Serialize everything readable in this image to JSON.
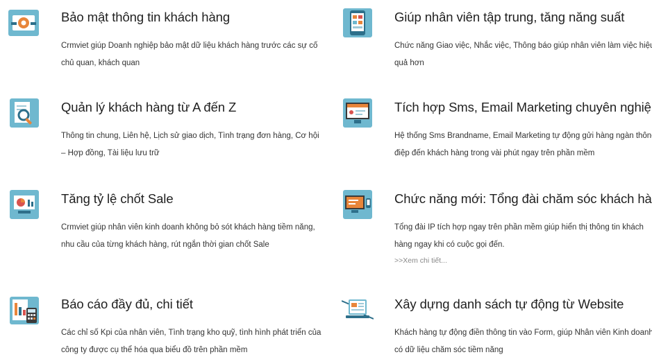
{
  "features": [
    {
      "title": "Bảo mật thông tin khách hàng",
      "desc": "Crmviet giúp Doanh nghiệp bảo mật dữ liệu khách hàng trước các sự cố chủ quan, khách quan",
      "icon": "security-gear-icon"
    },
    {
      "title": "Giúp nhân viên tập trung, tăng năng suất",
      "desc": "Chức năng Giao việc, Nhắc việc, Thông báo giúp nhân viên làm việc hiệu quả hơn",
      "icon": "mobile-app-icon"
    },
    {
      "title": "Quản lý khách hàng từ A đến Z",
      "desc": "Thông tin chung, Liên hệ, Lịch sử giao dịch, Tình trạng đơn hàng, Cơ hội – Hợp đồng, Tài liệu lưu trữ",
      "icon": "magnifier-document-icon"
    },
    {
      "title": "Tích hợp Sms, Email Marketing chuyên nghiệp",
      "desc": "Hệ thống Sms Brandname, Email Marketing tự động gửi hàng ngàn thông điệp đến khách hàng trong vài phút ngay trên phần mềm",
      "icon": "marketing-monitor-icon"
    },
    {
      "title": "Tăng tỷ lệ chốt Sale",
      "desc": "Crmviet giúp nhân viên kinh doanh không bỏ sót khách hàng tiềm năng, nhu cầu của từng khách hàng, rút ngắn thời gian chốt Sale",
      "icon": "sales-chart-icon"
    },
    {
      "title": "Chức năng mới: Tổng đài chăm sóc khách hàng",
      "desc": "Tổng đài IP tích hợp ngay trên phần mềm giúp hiển thị thông tin khách hàng ngay khi có cuộc gọi đến.",
      "more": ">>Xem chi tiết...",
      "icon": "call-center-monitor-icon"
    },
    {
      "title": "Báo cáo đầy đủ, chi tiết",
      "desc": "Các chỉ số Kpi của nhân viên, Tình trạng kho quỹ, tình hình phát triển của công ty được cụ thể hóa qua biểu đồ trên phần mềm",
      "icon": "report-calculator-icon"
    },
    {
      "title": "Xây dựng danh sách tự động từ Website",
      "desc": "Khách hàng tự động điền thông tin vào Form, giúp Nhân viên Kinh doanh có dữ liệu chăm sóc tiềm năng",
      "icon": "website-laptop-icon"
    }
  ],
  "colors": {
    "icon_bg": "#6fb8cf",
    "accent_orange": "#e8853a",
    "accent_red": "#d9534f"
  }
}
